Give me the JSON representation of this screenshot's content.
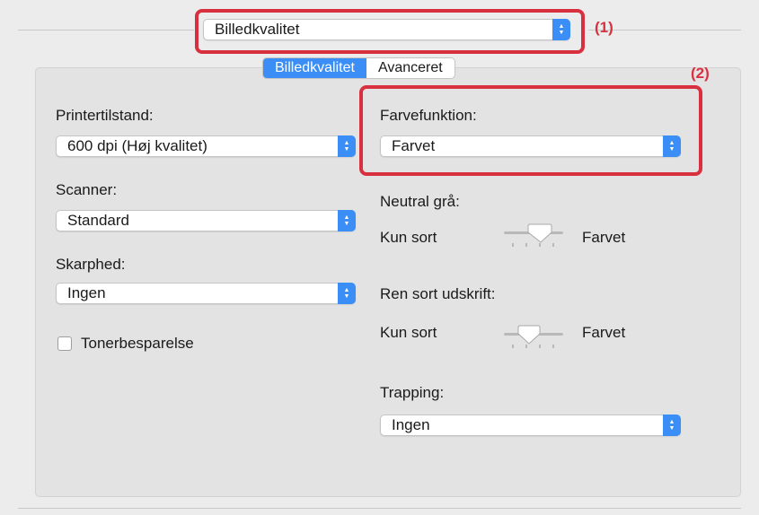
{
  "top_select": {
    "value": "Billedkvalitet"
  },
  "callouts": {
    "one": "(1)",
    "two": "(2)",
    "color": "#d8303f"
  },
  "tabs": [
    {
      "label": "Billedkvalitet",
      "active": true
    },
    {
      "label": "Avanceret",
      "active": false
    }
  ],
  "left": {
    "printer_mode": {
      "label": "Printertilstand:",
      "value": "600 dpi (Høj kvalitet)"
    },
    "scanner": {
      "label": "Scanner:",
      "value": "Standard"
    },
    "sharpness": {
      "label": "Skarphed:",
      "value": "Ingen"
    },
    "toner_save": {
      "label": "Tonerbesparelse",
      "checked": false
    }
  },
  "right": {
    "color_mode": {
      "label": "Farvefunktion:",
      "value": "Farvet"
    },
    "neutral_gray": {
      "label": "Neutral grå:",
      "min_label": "Kun sort",
      "max_label": "Farvet"
    },
    "pure_black": {
      "label": "Ren sort udskrift:",
      "min_label": "Kun sort",
      "max_label": "Farvet"
    },
    "trapping": {
      "label": "Trapping:",
      "value": "Ingen"
    }
  },
  "colors": {
    "accent": "#3b8ef5",
    "panel": "#e3e3e3"
  },
  "icons": {
    "stepper": "up-down-chevron-icon",
    "slider": "slider-knob-icon"
  }
}
